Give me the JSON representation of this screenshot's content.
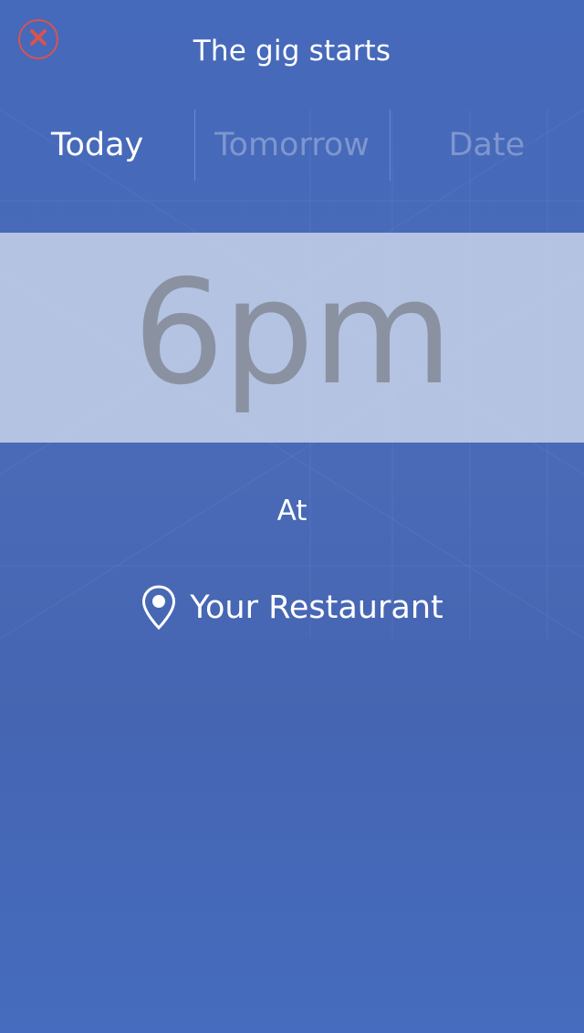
{
  "header": {
    "title": "The gig starts",
    "close_icon": "close-icon"
  },
  "tabs": [
    {
      "label": "Today",
      "active": true
    },
    {
      "label": "Tomorrow",
      "active": false
    },
    {
      "label": "Date",
      "active": false
    }
  ],
  "time": {
    "value": "6pm"
  },
  "venue": {
    "at_label": "At",
    "icon": "location-pin-icon",
    "name": "Your Restaurant"
  },
  "colors": {
    "background": "#4569bb",
    "accent_close": "#d9534f",
    "inactive_tab": "#7f96cf",
    "time_band": "#d4dcee",
    "time_text": "#8a92a2"
  }
}
